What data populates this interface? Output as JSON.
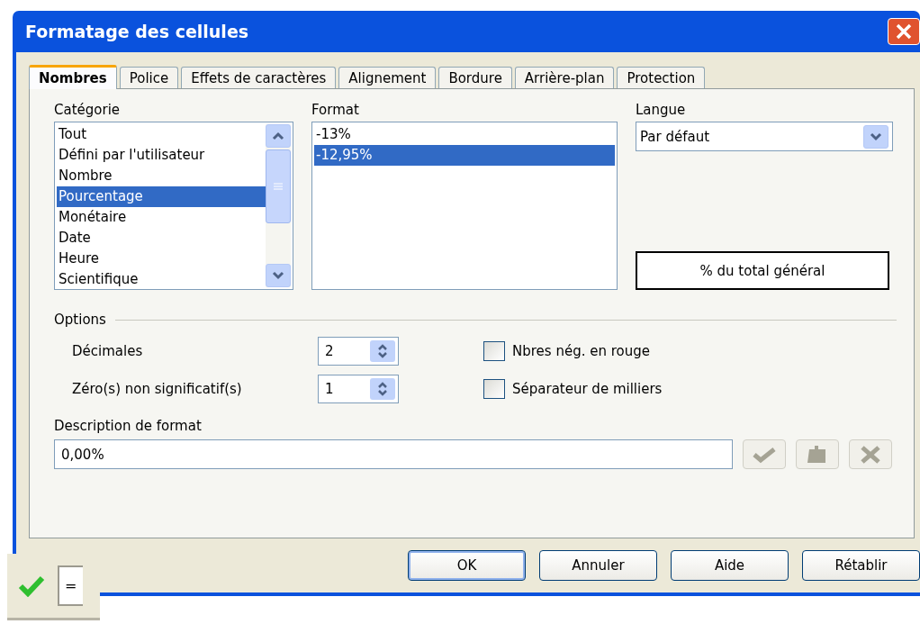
{
  "window": {
    "title": "Formatage des cellules"
  },
  "tabs": [
    {
      "label": "Nombres",
      "selected": true
    },
    {
      "label": "Police",
      "selected": false
    },
    {
      "label": "Effets de caractères",
      "selected": false
    },
    {
      "label": "Alignement",
      "selected": false
    },
    {
      "label": "Bordure",
      "selected": false
    },
    {
      "label": "Arrière-plan",
      "selected": false
    },
    {
      "label": "Protection",
      "selected": false
    }
  ],
  "category": {
    "label": "Catégorie",
    "items": [
      {
        "label": "Tout",
        "selected": false
      },
      {
        "label": "Défini par l'utilisateur",
        "selected": false
      },
      {
        "label": "Nombre",
        "selected": false
      },
      {
        "label": "Pourcentage",
        "selected": true
      },
      {
        "label": "Monétaire",
        "selected": false
      },
      {
        "label": "Date",
        "selected": false
      },
      {
        "label": "Heure",
        "selected": false
      },
      {
        "label": "Scientifique",
        "selected": false
      }
    ]
  },
  "format": {
    "label": "Format",
    "items": [
      {
        "label": "-13%",
        "selected": false
      },
      {
        "label": "-12,95%",
        "selected": true
      }
    ]
  },
  "language": {
    "label": "Langue",
    "value": "Par défaut"
  },
  "preview": "% du total général",
  "options": {
    "title": "Options",
    "spinners": [
      {
        "label": "Décimales",
        "value": "2"
      },
      {
        "label": "Zéro(s) non significatif(s)",
        "value": "1"
      }
    ],
    "checkboxes": [
      {
        "label": "Nbres nég. en rouge",
        "checked": false
      },
      {
        "label": "Séparateur de milliers",
        "checked": false
      }
    ]
  },
  "format_code": {
    "label": "Description de format",
    "value": "0,00%"
  },
  "buttons": [
    {
      "label": "OK",
      "default": true
    },
    {
      "label": "Annuler",
      "default": false
    },
    {
      "label": "Aide",
      "default": false
    },
    {
      "label": "Rétablir",
      "default": false
    }
  ],
  "formula_bar": {
    "value": "="
  }
}
